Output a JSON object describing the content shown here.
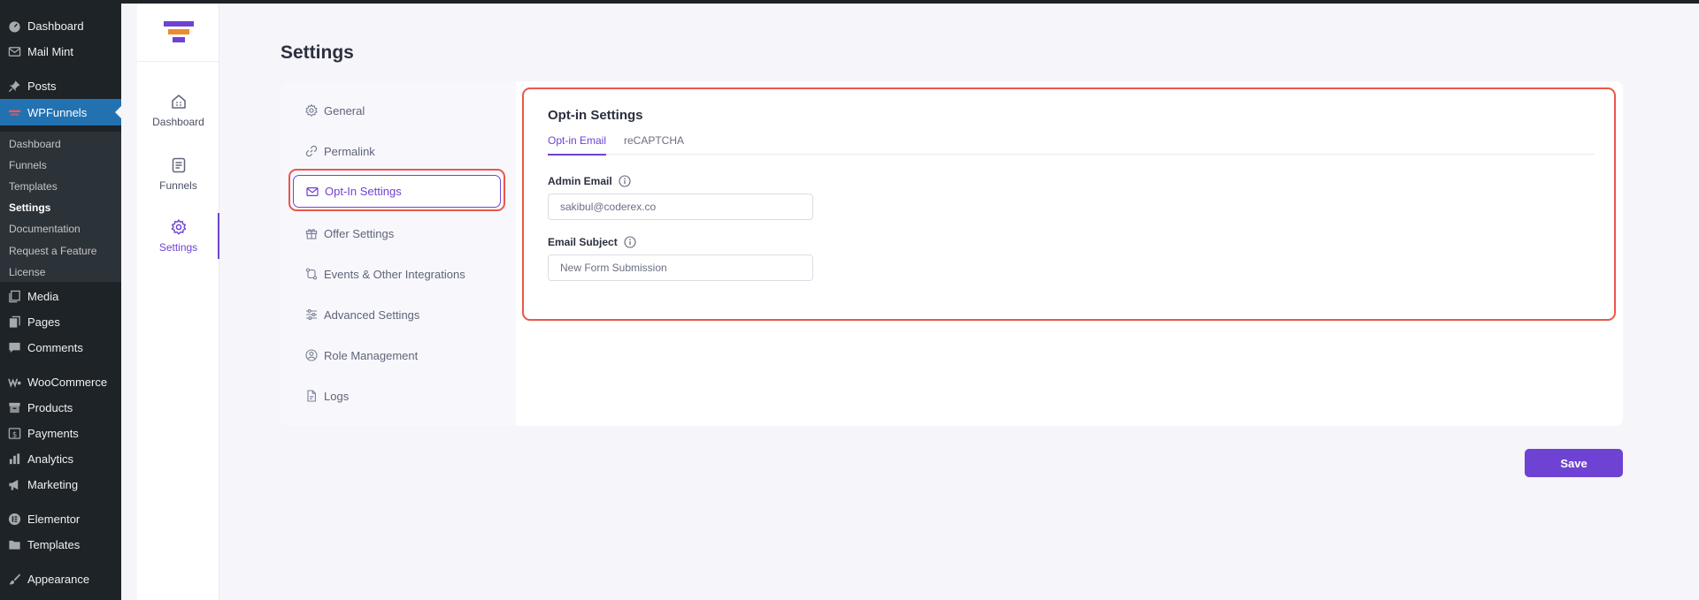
{
  "wp_menu": {
    "items": [
      {
        "label": "Dashboard",
        "icon": "dashboard-icon"
      },
      {
        "label": "Mail Mint",
        "icon": "mail-icon"
      },
      {
        "label": "Posts",
        "icon": "pin-icon"
      },
      {
        "label": "WPFunnels",
        "icon": "funnel-icon"
      },
      {
        "label": "Media",
        "icon": "media-icon"
      },
      {
        "label": "Pages",
        "icon": "pages-icon"
      },
      {
        "label": "Comments",
        "icon": "comments-icon"
      },
      {
        "label": "WooCommerce",
        "icon": "woo-icon"
      },
      {
        "label": "Products",
        "icon": "products-icon"
      },
      {
        "label": "Payments",
        "icon": "payments-icon"
      },
      {
        "label": "Analytics",
        "icon": "analytics-icon"
      },
      {
        "label": "Marketing",
        "icon": "megaphone-icon"
      },
      {
        "label": "Elementor",
        "icon": "elementor-icon"
      },
      {
        "label": "Templates",
        "icon": "folder-icon"
      },
      {
        "label": "Appearance",
        "icon": "brush-icon"
      }
    ],
    "submenu": [
      "Dashboard",
      "Funnels",
      "Templates",
      "Settings",
      "Documentation",
      "Request a Feature",
      "License"
    ]
  },
  "rail": {
    "items": [
      {
        "label": "Dashboard",
        "icon": "dashboard-icon"
      },
      {
        "label": "Funnels",
        "icon": "funnels-icon"
      },
      {
        "label": "Settings",
        "icon": "gear-icon"
      }
    ]
  },
  "page": {
    "title": "Settings"
  },
  "settings_nav": {
    "items": [
      {
        "label": "General",
        "icon": "gear-icon"
      },
      {
        "label": "Permalink",
        "icon": "link-icon"
      },
      {
        "label": "Opt-In Settings",
        "icon": "mail-icon"
      },
      {
        "label": "Offer Settings",
        "icon": "gift-icon"
      },
      {
        "label": "Events & Other Integrations",
        "icon": "integration-icon"
      },
      {
        "label": "Advanced Settings",
        "icon": "sliders-icon"
      },
      {
        "label": "Role Management",
        "icon": "user-gear-icon"
      },
      {
        "label": "Logs",
        "icon": "file-icon"
      }
    ]
  },
  "panel": {
    "title": "Opt-in Settings",
    "tabs": [
      "Opt-in Email",
      "reCAPTCHA"
    ],
    "admin_email": {
      "label": "Admin Email",
      "value": "sakibul@coderex.co"
    },
    "email_subject": {
      "label": "Email Subject",
      "value": "New Form Submission"
    }
  },
  "actions": {
    "save_label": "Save"
  },
  "colors": {
    "accent": "#6e42d3",
    "highlight": "#e9574c",
    "wp_active": "#2271b1"
  }
}
